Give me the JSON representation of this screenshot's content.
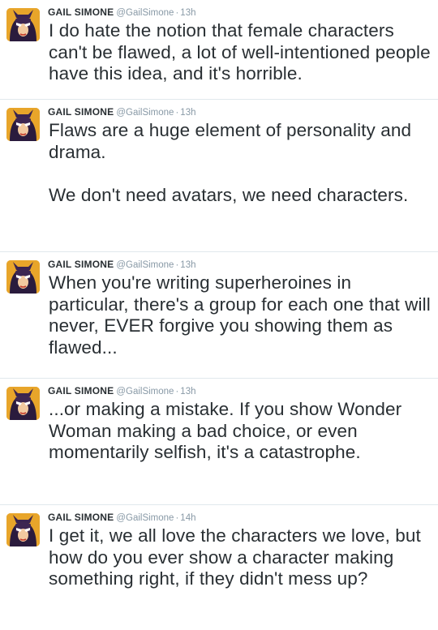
{
  "tweets": [
    {
      "name": "GAIL SIMONE",
      "handle": "@GailSimone",
      "separator": "·",
      "time": "13h",
      "avatar_icon": "batgirl-avatar-icon",
      "text": "I do hate the notion that female characters can't be flawed, a lot of well-intentioned people have this idea, and it's horrible."
    },
    {
      "name": "GAIL SIMONE",
      "handle": "@GailSimone",
      "separator": "·",
      "time": "13h",
      "avatar_icon": "batgirl-avatar-icon",
      "text": "Flaws are a huge element of personality and drama.\n\nWe don't need avatars, we need characters."
    },
    {
      "name": "GAIL SIMONE",
      "handle": "@GailSimone",
      "separator": "·",
      "time": "13h",
      "avatar_icon": "batgirl-avatar-icon",
      "text": "When you're writing superheroines in particular, there's a group for each one that will never, EVER forgive you showing them as flawed..."
    },
    {
      "name": "GAIL SIMONE",
      "handle": "@GailSimone",
      "separator": "·",
      "time": "13h",
      "avatar_icon": "batgirl-avatar-icon",
      "text": "...or making a mistake. If you show Wonder Woman making a bad choice, or even momentarily selfish, it's a catastrophe."
    },
    {
      "name": "GAIL SIMONE",
      "handle": "@GailSimone",
      "separator": "·",
      "time": "14h",
      "avatar_icon": "batgirl-avatar-icon",
      "text": "I get it, we all love the characters we love, but how do you ever show a character making something right, if they didn't mess up?"
    }
  ],
  "colors": {
    "text": "#292f33",
    "meta": "#8899a6",
    "divider": "#e1e8ed",
    "avatar_bg": "#e8a52a"
  }
}
